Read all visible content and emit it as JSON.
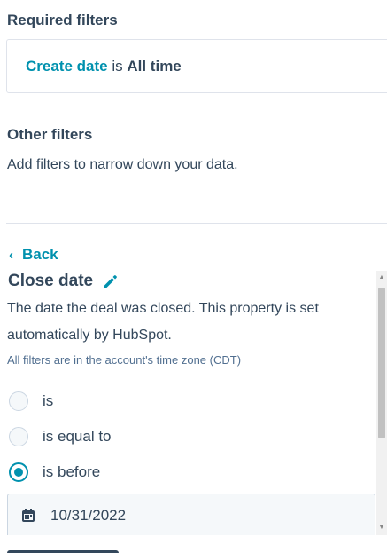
{
  "required_filters": {
    "title": "Required filters",
    "link_text": "Create date",
    "operator": "is",
    "value": "All time"
  },
  "other_filters": {
    "title": "Other filters",
    "description": "Add filters to narrow down your data."
  },
  "panel": {
    "back_label": "Back",
    "property_title": "Close date",
    "description": "The date the deal was closed. This property is set automatically by HubSpot.",
    "timezone_note": "All filters are in the account's time zone (CDT)",
    "options": [
      {
        "label": "is",
        "selected": false
      },
      {
        "label": "is equal to",
        "selected": false
      },
      {
        "label": "is before",
        "selected": true
      }
    ],
    "date_value": "10/31/2022"
  },
  "colors": {
    "accent": "#0091ae",
    "text": "#33475b",
    "border": "#cbd6e2"
  },
  "icons": [
    "chevron-left-icon",
    "pencil-icon",
    "calendar-icon"
  ]
}
